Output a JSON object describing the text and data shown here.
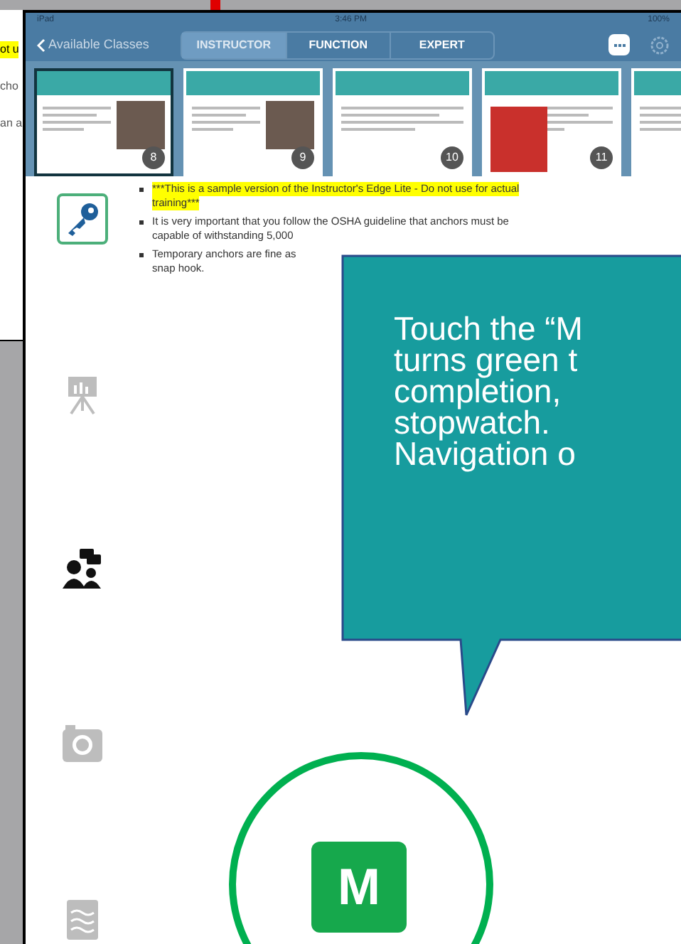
{
  "background_window": {
    "fragments": [
      {
        "text": "ot u",
        "highlighted": true
      },
      {
        "text": "cho",
        "highlighted": false
      },
      {
        "text": "an a",
        "highlighted": false
      }
    ]
  },
  "status_bar": {
    "device": "iPad",
    "time": "3:46 PM",
    "battery": "100%"
  },
  "nav_bar": {
    "back": "Available Classes",
    "tabs": [
      {
        "label": "INSTRUCTOR",
        "selected": true
      },
      {
        "label": "FUNCTION",
        "selected": false
      },
      {
        "label": "EXPERT",
        "selected": false
      }
    ]
  },
  "slides": [
    {
      "number": "8",
      "selected": true,
      "kind": "photo"
    },
    {
      "number": "9",
      "selected": false,
      "kind": "photo"
    },
    {
      "number": "10",
      "selected": false,
      "kind": "text"
    },
    {
      "number": "11",
      "selected": false,
      "kind": "chart"
    },
    {
      "selected": false,
      "kind": "diagram"
    }
  ],
  "sidebar": [
    {
      "kind": "key",
      "selected": true,
      "enabled": true
    },
    {
      "kind": "easel",
      "selected": false,
      "enabled": false
    },
    {
      "kind": "people",
      "selected": false,
      "enabled": true
    },
    {
      "kind": "camera",
      "selected": false,
      "enabled": false
    },
    {
      "kind": "notes",
      "selected": false,
      "enabled": false
    }
  ],
  "notes": [
    {
      "lines": [
        "***This is a sample version of the Instructor's Edge Lite - Do not use for actual",
        "training***"
      ],
      "highlighted": true
    },
    {
      "lines": [
        "It is very important that you follow the OSHA guideline that anchors must be",
        "capable of withstanding 5,000"
      ],
      "highlighted": false
    },
    {
      "lines": [
        "Temporary anchors are fine as",
        "snap hook."
      ],
      "highlighted": false
    }
  ],
  "callout": {
    "lines": [
      "Touch the “M",
      "turns green t",
      "completion,",
      "stopwatch.",
      "Navigation o"
    ]
  },
  "m_button": {
    "label": "M"
  }
}
